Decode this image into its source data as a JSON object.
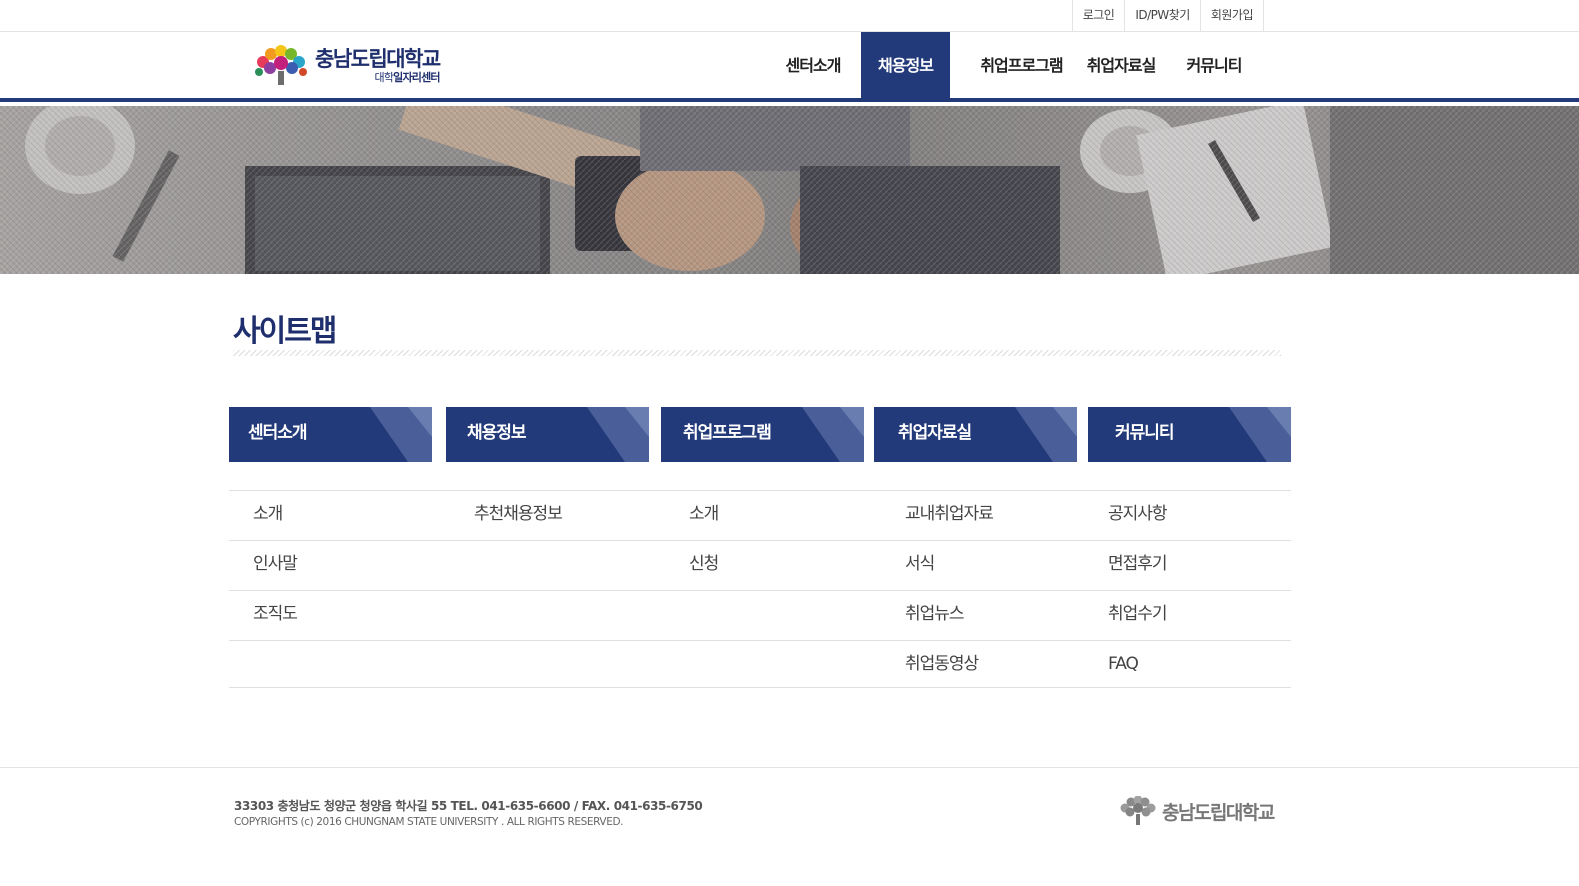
{
  "utility_nav": [
    "로그인",
    "ID/PW찾기",
    "회원가입"
  ],
  "logo": {
    "name": "충남도립대학교",
    "sub_prefix": "대학",
    "sub_emphasis": "일자리센터"
  },
  "gnb": [
    {
      "label": "센터소개",
      "active": false
    },
    {
      "label": "채용정보",
      "active": true
    },
    {
      "label": "취업프로그램",
      "active": false
    },
    {
      "label": "취업자료실",
      "active": false
    },
    {
      "label": "커뮤니티",
      "active": false
    }
  ],
  "page_title": "사이트맵",
  "sitemap": {
    "columns": [
      {
        "title": "센터소개",
        "items": [
          "소개",
          "인사말",
          "조직도"
        ]
      },
      {
        "title": "채용정보",
        "items": [
          "추천채용정보"
        ]
      },
      {
        "title": "취업프로그램",
        "items": [
          "소개",
          "신청"
        ]
      },
      {
        "title": "취업자료실",
        "items": [
          "교내취업자료",
          "서식",
          "취업뉴스",
          "취업동영상"
        ]
      },
      {
        "title": "커뮤니티",
        "items": [
          "공지사항",
          "면접후기",
          "취업수기",
          "FAQ"
        ]
      }
    ]
  },
  "footer": {
    "address": "33303  충청남도 청양군 청양읍 학사길 55  TEL. 041-635-6600  /  FAX. 041-635-6750",
    "copyright": "COPYRIGHTS (c) 2016  CHUNGNAM STATE UNIVERSITY . ALL RIGHTS RESERVED.",
    "logo_name": "충남도립대학교"
  },
  "colors": {
    "primary": "#233a7a",
    "secondary": "#4a5f9a"
  }
}
